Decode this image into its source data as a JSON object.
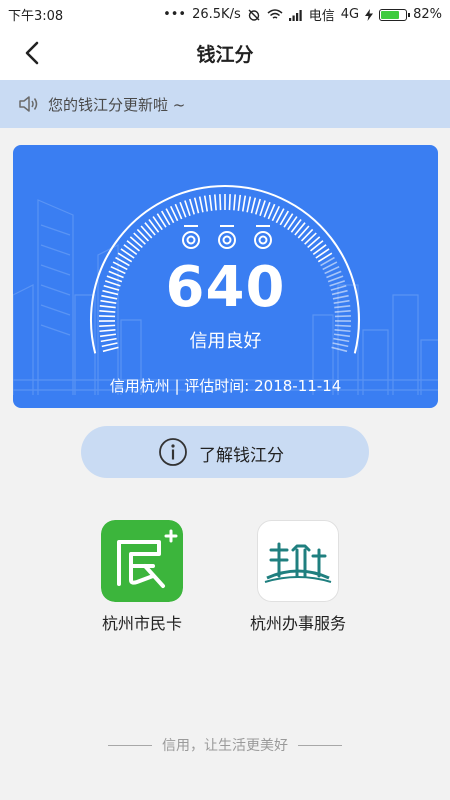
{
  "status_bar": {
    "time": "下午3:08",
    "dots": "•••",
    "network_speed": "26.5K/s",
    "carrier": "电信",
    "network_type": "4G",
    "battery_percent": "82%",
    "battery_level": 0.82
  },
  "nav": {
    "title": "钱江分"
  },
  "notice": {
    "text": "您的钱江分更新啦 ~"
  },
  "score_card": {
    "score": "640",
    "level": "信用良好",
    "footer": "信用杭州 | 评估时间: 2018-11-14",
    "colors": {
      "background": "#3a7ef2"
    }
  },
  "learn_button": {
    "label": "了解钱江分"
  },
  "apps": [
    {
      "label": "杭州市民卡",
      "icon": "citizen-card-icon",
      "color": "#3cb53c"
    },
    {
      "label": "杭州办事服务",
      "icon": "hangzhou-service-icon",
      "color": "#ffffff"
    }
  ],
  "slogan": {
    "text": "信用，让生活更美好"
  }
}
